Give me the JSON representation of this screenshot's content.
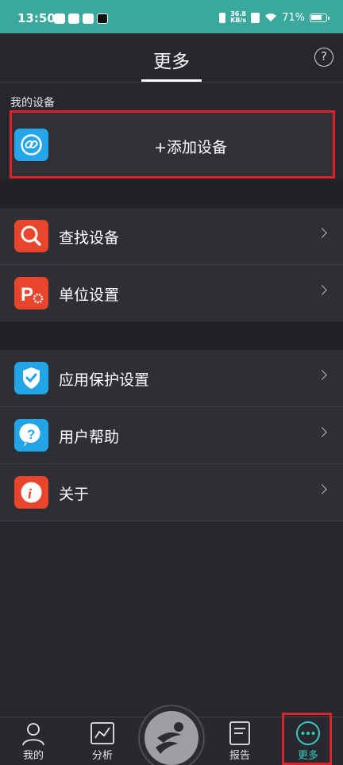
{
  "status_bar": {
    "time": "13:50",
    "net_speed_value": "36.8",
    "net_speed_unit": "KB/s",
    "battery": "71%"
  },
  "header": {
    "title": "更多"
  },
  "devices": {
    "section_label": "我的设备",
    "add_label": "+添加设备"
  },
  "menu_group_1": [
    {
      "label": "查找设备",
      "icon": "search-icon",
      "color": "#e8462c"
    },
    {
      "label": "单位设置",
      "icon": "unit-settings-icon",
      "color": "#e8462c"
    }
  ],
  "menu_group_2": [
    {
      "label": "应用保护设置",
      "icon": "shield-check-icon",
      "color": "#23a4e6"
    },
    {
      "label": "用户帮助",
      "icon": "help-bubble-icon",
      "color": "#23a4e6"
    },
    {
      "label": "关于",
      "icon": "info-icon",
      "color": "#e8462c"
    }
  ],
  "bottom_nav": {
    "me": "我的",
    "analysis": "分析",
    "report": "报告",
    "more": "更多"
  },
  "colors": {
    "accent": "#3aa89d",
    "highlight": "#e0202a",
    "background": "#26282d"
  }
}
